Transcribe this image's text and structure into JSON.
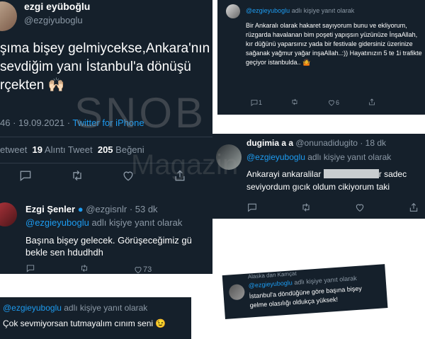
{
  "main_tweet": {
    "name": "ezgi eyüboğlu",
    "handle": "@ezgiyuboglu",
    "text_lines": [
      "şıma bişey gelmiycekse,Ankara'nın",
      "sevdiğim yanı İstanbul'a dönüşü",
      "rçekten 🙌🏻"
    ],
    "time_date": "46 · 19.09.2021 ·",
    "source": "Twitter for iPhone",
    "retweet_label": "etweet",
    "quote_count": "19",
    "quote_label": "Alıntı Tweet",
    "like_count": "205",
    "like_label": "Beğeni"
  },
  "reply_ezgi_senler": {
    "name": "Ezgi Şenler",
    "handle": "@ezgisnlr",
    "time": "· 53 dk",
    "reply_to": "@ezgieyuboglu",
    "reply_label": "adlı kişiye yanıt olarak",
    "text_lines": [
      "Başına bişey gelecek. Görüşeceğimiz gü",
      "bekle sen hdudhdh"
    ],
    "like_count": "73"
  },
  "reply_top_right": {
    "reply_to": "@ezgieyuboglu",
    "reply_label": "adlı kişiye yanıt olarak",
    "text": "Bir Ankaralı olarak hakaret sayıyorum bunu ve ekliyorum, rüzgarda havalanan bim poşeti yapışsın yüzünüze İnşaAllah, kır düğünü yaparsınız yada bir festivale gidersiniz üzerinize sağanak  yağmur yağar inşaAllah..:)) Hayatınızın 5 te 1i trafikte geçiyor istanbulda.. 🤷",
    "reply_count": "1",
    "like_count": "6"
  },
  "reply_dugimia": {
    "name": "dugimia a a",
    "handle": "@onunadidugito",
    "time": "· 18 dk",
    "reply_to": "@ezgieyuboglu",
    "reply_label": "adlı kişiye yanıt olarak",
    "text_line1_a": "Ankarayi ankaralilar",
    "text_line1_b": "r sadec",
    "text_line2": "seviyordum gıcık oldum cikiyorum taki"
  },
  "reply_bottom_left": {
    "reply_to": "@ezgieyuboglu",
    "reply_label": "adlı kişiye yanıt olarak",
    "text": "Çok sevmiyorsan tutmayalım cınım seni 😉"
  },
  "reply_bottom_right": {
    "name_partial": "Alaska dan Kamçat",
    "reply_to": "@ezgieyuboglu",
    "reply_label": "adlı kişiye yanıt olarak",
    "text_lines": [
      "İstanbul'a döndüğüne göre başına bişey",
      "gelme olasılığı oldukça yüksek!"
    ]
  },
  "watermark": {
    "big": "SNOB",
    "small": "Magazin"
  }
}
